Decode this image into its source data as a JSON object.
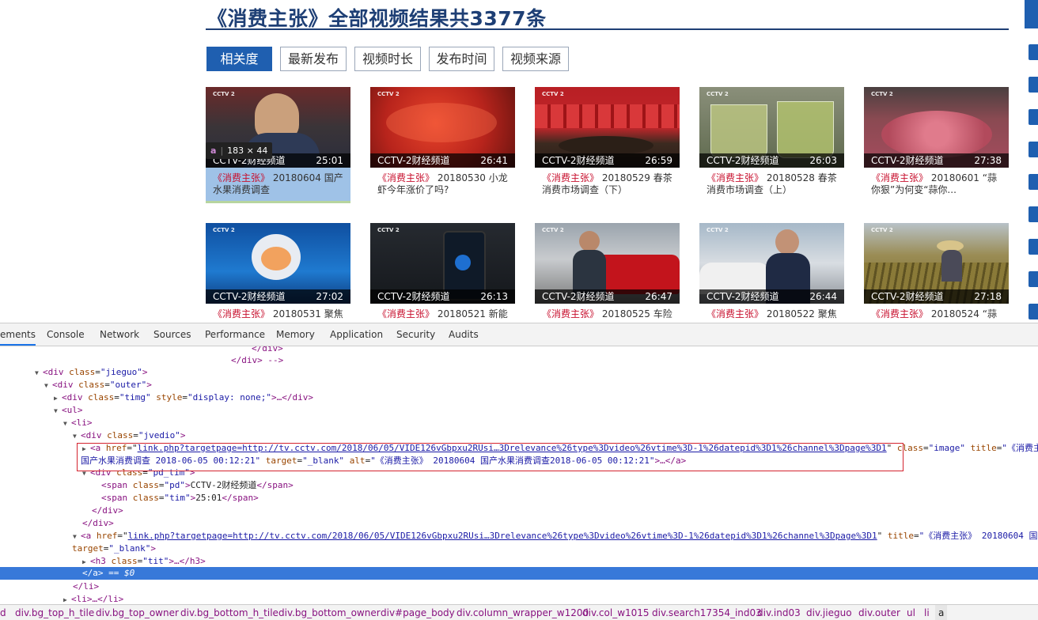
{
  "page": {
    "title": "《消费主张》全部视频结果共3377条",
    "sort_tabs": [
      {
        "label": "相关度",
        "active": true
      },
      {
        "label": "最新发布",
        "active": false
      },
      {
        "label": "视频时长",
        "active": false
      },
      {
        "label": "发布时间",
        "active": false
      },
      {
        "label": "视频来源",
        "active": false
      }
    ],
    "logo_text": "CCTV 2",
    "tooltip": {
      "tag": "a",
      "size": "183 × 44"
    },
    "row1": [
      {
        "channel": "CCTV-2财经频道",
        "duration": "25:01",
        "kw": "《消费主张》",
        "desc": " 20180604 国产水果消费调查"
      },
      {
        "channel": "CCTV-2财经频道",
        "duration": "26:41",
        "kw": "《消费主张》",
        "desc": " 20180530 小龙虾今年涨价了吗?"
      },
      {
        "channel": "CCTV-2财经频道",
        "duration": "26:59",
        "kw": "《消费主张》",
        "desc": " 20180529 春茶消费市场调查（下）"
      },
      {
        "channel": "CCTV-2财经频道",
        "duration": "26:03",
        "kw": "《消费主张》",
        "desc": " 20180528 春茶消费市场调查（上）"
      },
      {
        "channel": "CCTV-2财经频道",
        "duration": "27:38",
        "kw": "《消费主张》",
        "desc": " 20180601 “蒜你狠”为何变“蒜你..."
      }
    ],
    "row2": [
      {
        "channel": "CCTV-2财经频道",
        "duration": "27:02",
        "kw": "《消费主张》",
        "desc": " 20180531 聚焦"
      },
      {
        "channel": "CCTV-2财经频道",
        "duration": "26:13",
        "kw": "《消费主张》",
        "desc": " 20180521 新能"
      },
      {
        "channel": "CCTV-2财经频道",
        "duration": "26:47",
        "kw": "《消费主张》",
        "desc": " 20180525 车险"
      },
      {
        "channel": "CCTV-2财经频道",
        "duration": "26:44",
        "kw": "《消费主张》",
        "desc": " 20180522 聚焦"
      },
      {
        "channel": "CCTV-2财经频道",
        "duration": "27:18",
        "kw": "《消费主张》",
        "desc": " 20180524 “蒜"
      }
    ]
  },
  "devtools": {
    "tabs": [
      "ements",
      "Console",
      "Network",
      "Sources",
      "Performance",
      "Memory",
      "Application",
      "Security",
      "Audits"
    ],
    "active_tab": "ements",
    "dom": {
      "l1": "</div>",
      "l2": "</div> -->",
      "l3_tag": "div",
      "l3_attr": "class",
      "l3_val": "\"jieguo\"",
      "l4_tag": "div",
      "l4_attr": "class",
      "l4_val": "\"outer\"",
      "l5_tag": "div",
      "l5_a1": "class",
      "l5_v1": "\"timg\"",
      "l5_a2": "style",
      "l5_v2": "\"display: none;\"",
      "l5_end": ">…</div>",
      "l6": "<ul>",
      "l7": "<li>",
      "l8_tag": "div",
      "l8_attr": "class",
      "l8_val": "\"jvedio\"",
      "l9_pre": "<a ",
      "l9_attr": "href",
      "l9_link": "link.php?targetpage=http://tv.cctv.com/2018/06/05/VIDE126vGbpxu2RUsi…3Drelevance%26type%3Dvideo%26vtime%3D-1%26datepid%3D1%26channel%3Dpage%3D1",
      "l9_a2": "class",
      "l9_v2": "\"image\"",
      "l9_a3": "title",
      "l9_v3": "\"《消费主张",
      "l10_text": "国产水果消费调查  2018-06-05 00:12:21\"",
      "l10_a1": "target",
      "l10_v1": "\"_blank\"",
      "l10_a2": "alt",
      "l10_v2": "\"《消费主张》 20180604 国产水果消费调查2018-06-05 00:12:21\"",
      "l10_end": ">…</a>",
      "l11_tag": "div",
      "l11_attr": "class",
      "l11_val": "\"pd_tim\"",
      "l12_attr": "class",
      "l12_val": "\"pd\"",
      "l12_text": "CCTV-2财经频道",
      "l13_attr": "class",
      "l13_val": "\"tim\"",
      "l13_text": "25:01",
      "l14": "</div>",
      "l15": "</div>",
      "l16_pre": "<a ",
      "l16_attr": "href",
      "l16_link": "link.php?targetpage=http://tv.cctv.com/2018/06/05/VIDE126vGbpxu2RUsi…3Drelevance%26type%3Dvideo%26vtime%3D-1%26datepid%3D1%26channel%3Dpage%3D1",
      "l16_a2": "title",
      "l16_v2": "\"《消费主张》 20180604 国",
      "l17_a1": "target",
      "l17_v1": "\"_blank\"",
      "l18_tag": "h3",
      "l18_attr": "class",
      "l18_val": "\"tit\"",
      "l18_end": ">…</h3>",
      "l19": "</a>",
      "l19_suffix": " == $0",
      "l20": "</li>",
      "l21": "<li>…</li>"
    },
    "breadcrumbs": [
      "d",
      "div.bg_top_h_tile",
      "div.bg_top_owner",
      "div.bg_bottom_h_tile",
      "div.bg_bottom_owner",
      "div#page_body",
      "div.column_wrapper_w1200",
      "div.col_w1015",
      "div.search17354_ind03",
      "div.ind03",
      "div.jieguo",
      "div.outer",
      "ul",
      "li",
      "a"
    ]
  },
  "colors": {
    "brand": "#1e3f75",
    "accent": "#1f5fb0",
    "keyword": "#c8102e",
    "selection": "#3879d9",
    "outline": "#d4232f"
  }
}
